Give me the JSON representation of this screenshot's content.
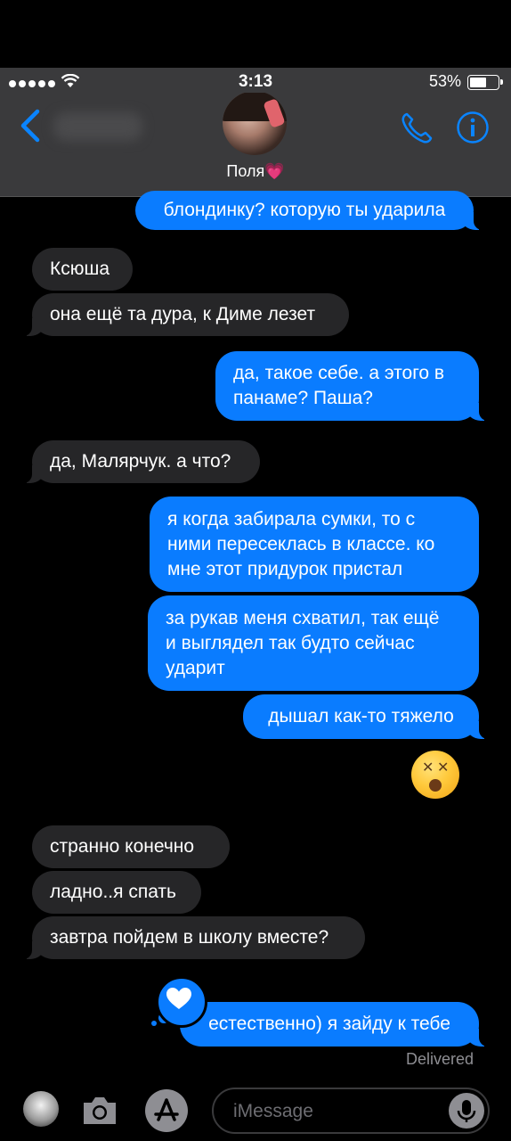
{
  "status_bar": {
    "time": "3:13",
    "battery": "53%",
    "battery_level": 0.53
  },
  "header": {
    "contact_name": "Поля💗"
  },
  "messages": [
    {
      "from": "me",
      "text": "блондинку? которую ты ударила"
    },
    {
      "from": "them",
      "text": "Ксюша"
    },
    {
      "from": "them",
      "text": "она ещё та дура, к Диме лезет"
    },
    {
      "from": "me",
      "lines": [
        "да, такое себе. а этого в",
        "панаме? Паша?"
      ]
    },
    {
      "from": "them",
      "text": "да, Малярчук. а что?"
    },
    {
      "from": "me",
      "lines": [
        "я когда забирала сумки, то с",
        "ними пересеклась в классе. ко",
        "мне этот придурок пристал"
      ]
    },
    {
      "from": "me",
      "lines": [
        "за рукав меня схватил, так ещё",
        "и выглядел так будто сейчас",
        "ударит"
      ]
    },
    {
      "from": "me",
      "text": "дышал как-то тяжело"
    },
    {
      "from": "me",
      "emoji": "dizzy-face-emoji"
    },
    {
      "from": "them",
      "text": "странно конечно"
    },
    {
      "from": "them",
      "text": "ладно..я спать"
    },
    {
      "from": "them",
      "text": "завтра пойдем в школу вместе?"
    },
    {
      "from": "me",
      "text": "естественно) я зайду к тебе",
      "reaction": "heart"
    }
  ],
  "delivered_label": "Delivered",
  "compose": {
    "placeholder": "iMessage"
  },
  "colors": {
    "outgoing": "#0a7cff",
    "incoming": "#262628",
    "accent": "#0a84ff",
    "header_bg": "#3a3a3c"
  }
}
